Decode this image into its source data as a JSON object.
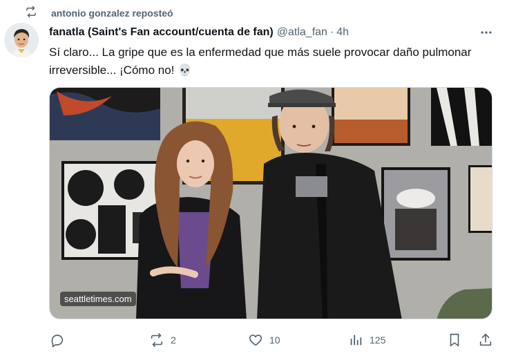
{
  "repost": {
    "icon": "repost-icon",
    "text": "antonio gonzalez reposteó"
  },
  "post": {
    "author_name": "fanatla (Saint's Fan account/cuenta de fan)",
    "handle": "@atla_fan",
    "separator": "·",
    "time": "4h",
    "text": "Sí claro... La gripe que es la enfermedad que más suele provocar daño pulmonar irreversible... ¡Cómo no! 💀"
  },
  "media": {
    "watermark": "seattletimes.com",
    "alt_description_icon": "photo-image"
  },
  "actions": {
    "reply_count": "",
    "repost_count": "2",
    "like_count": "10",
    "views_count": "125"
  },
  "colors": {
    "text_primary": "#0f1419",
    "text_secondary": "#536471",
    "border": "#cfd9de"
  }
}
